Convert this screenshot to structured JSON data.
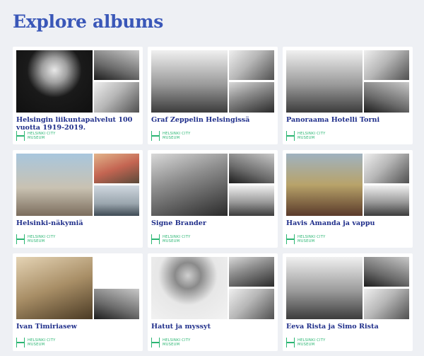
{
  "page_title": "Explore albums",
  "museum_logo": {
    "line1": "HELSINKI CITY",
    "line2": "MUSEUM"
  },
  "albums": [
    {
      "title": "Helsingin liikuntapalvelut 100 vuotta 1919-2019."
    },
    {
      "title": "Graf Zeppelin Helsingissä"
    },
    {
      "title": "Panoraama Hotelli Torni"
    },
    {
      "title": "Helsinki-näkymiä"
    },
    {
      "title": "Signe Brander"
    },
    {
      "title": "Havis Amanda ja vappu"
    },
    {
      "title": "Ivan Timiriasew"
    },
    {
      "title": "Hatut ja myssyt"
    },
    {
      "title": "Eeva Rista ja Simo Rista"
    }
  ]
}
